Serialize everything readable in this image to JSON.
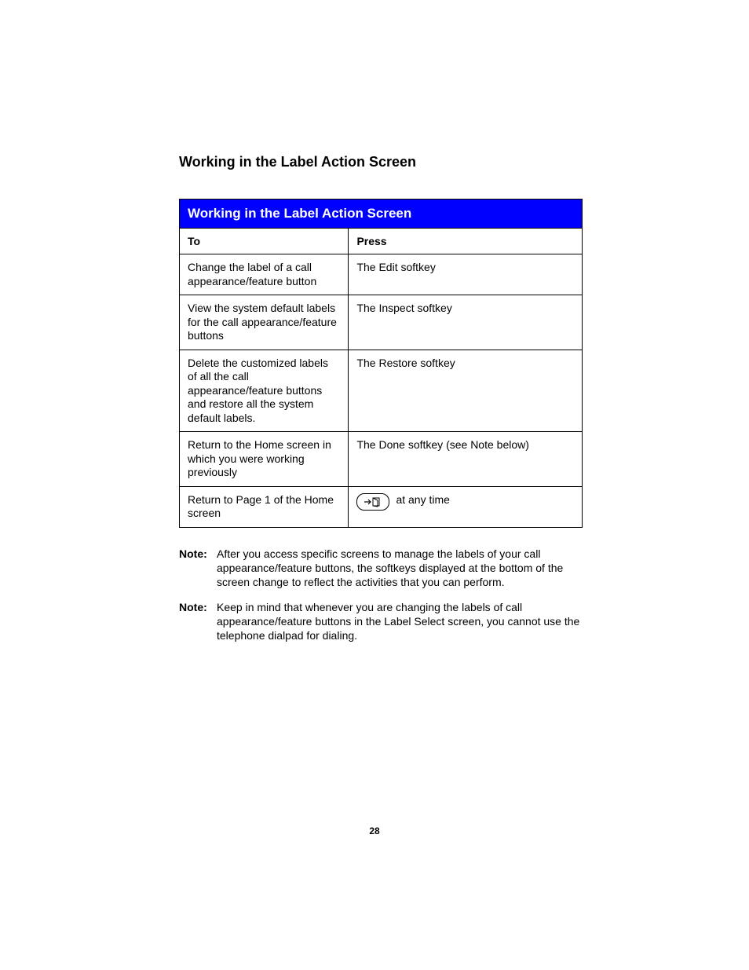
{
  "heading": "Working in the Label Action Screen",
  "table": {
    "title": "Working in the Label Action Screen",
    "headers": {
      "col1": "To",
      "col2": "Press"
    },
    "rows": [
      {
        "to": "Change the label of a call appearance/feature button",
        "press": "The Edit softkey",
        "icon": false
      },
      {
        "to": "View the system default labels for the call appearance/feature buttons",
        "press": "The Inspect softkey",
        "icon": false
      },
      {
        "to": "Delete the customized labels of all the call appearance/feature buttons and restore all the system default labels.",
        "press": "The Restore softkey",
        "icon": false
      },
      {
        "to": "Return to the Home screen in which you were working previously",
        "press": "The Done softkey (see Note below)",
        "icon": false
      },
      {
        "to": "Return to Page 1 of the Home screen",
        "press": "at any time",
        "icon": true
      }
    ]
  },
  "notes": [
    {
      "label": "Note:",
      "text": "After you access specific screens to manage the labels of your call appearance/feature buttons, the softkeys displayed at the bottom of the screen change to reflect the activities that you can perform."
    },
    {
      "label": "Note:",
      "text": "Keep in mind that whenever you are changing the labels of call appearance/feature buttons in the Label Select screen, you cannot use the telephone dialpad for dialing."
    }
  ],
  "page_number": "28"
}
